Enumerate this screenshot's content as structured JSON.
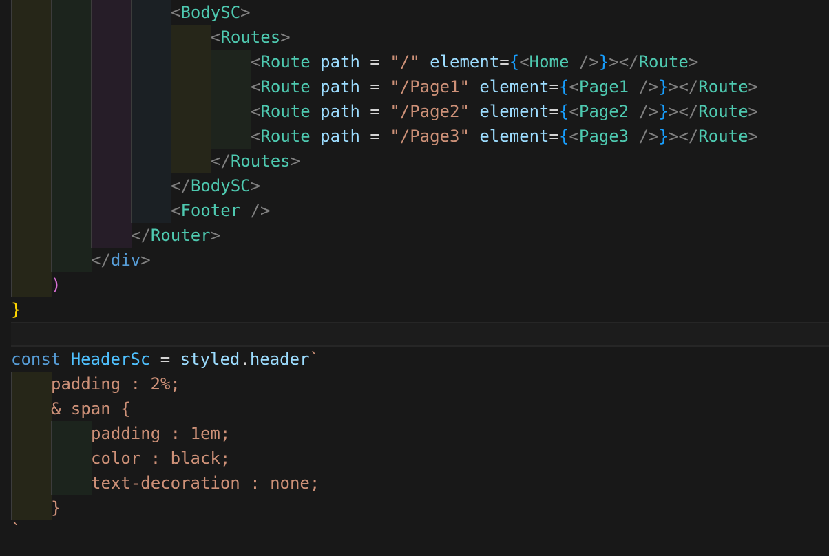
{
  "editor": {
    "lines": [
      [
        {
          "t": "<",
          "c": "punc"
        },
        {
          "t": "BodySC",
          "c": "tag"
        },
        {
          "t": ">",
          "c": "punc"
        }
      ],
      [
        {
          "t": "<",
          "c": "punc"
        },
        {
          "t": "Routes",
          "c": "tag"
        },
        {
          "t": ">",
          "c": "punc"
        }
      ],
      [
        {
          "t": "<",
          "c": "punc"
        },
        {
          "t": "Route",
          "c": "tag"
        },
        {
          "t": " ",
          "c": "op"
        },
        {
          "t": "path",
          "c": "attr"
        },
        {
          "t": " = ",
          "c": "op"
        },
        {
          "t": "\"/\"",
          "c": "str"
        },
        {
          "t": " ",
          "c": "op"
        },
        {
          "t": "element",
          "c": "attr"
        },
        {
          "t": "=",
          "c": "op"
        },
        {
          "t": "{",
          "c": "brace"
        },
        {
          "t": "<",
          "c": "punc"
        },
        {
          "t": "Home",
          "c": "tag"
        },
        {
          "t": " />",
          "c": "punc"
        },
        {
          "t": "}",
          "c": "brace"
        },
        {
          "t": "></",
          "c": "punc"
        },
        {
          "t": "Route",
          "c": "tag"
        },
        {
          "t": ">",
          "c": "punc"
        }
      ],
      [
        {
          "t": "<",
          "c": "punc"
        },
        {
          "t": "Route",
          "c": "tag"
        },
        {
          "t": " ",
          "c": "op"
        },
        {
          "t": "path",
          "c": "attr"
        },
        {
          "t": " = ",
          "c": "op"
        },
        {
          "t": "\"/Page1\"",
          "c": "str"
        },
        {
          "t": " ",
          "c": "op"
        },
        {
          "t": "element",
          "c": "attr"
        },
        {
          "t": "=",
          "c": "op"
        },
        {
          "t": "{",
          "c": "brace"
        },
        {
          "t": "<",
          "c": "punc"
        },
        {
          "t": "Page1",
          "c": "tag"
        },
        {
          "t": " />",
          "c": "punc"
        },
        {
          "t": "}",
          "c": "brace"
        },
        {
          "t": "></",
          "c": "punc"
        },
        {
          "t": "Route",
          "c": "tag"
        },
        {
          "t": ">",
          "c": "punc"
        }
      ],
      [
        {
          "t": "<",
          "c": "punc"
        },
        {
          "t": "Route",
          "c": "tag"
        },
        {
          "t": " ",
          "c": "op"
        },
        {
          "t": "path",
          "c": "attr"
        },
        {
          "t": " = ",
          "c": "op"
        },
        {
          "t": "\"/Page2\"",
          "c": "str"
        },
        {
          "t": " ",
          "c": "op"
        },
        {
          "t": "element",
          "c": "attr"
        },
        {
          "t": "=",
          "c": "op"
        },
        {
          "t": "{",
          "c": "brace"
        },
        {
          "t": "<",
          "c": "punc"
        },
        {
          "t": "Page2",
          "c": "tag"
        },
        {
          "t": " />",
          "c": "punc"
        },
        {
          "t": "}",
          "c": "brace"
        },
        {
          "t": "></",
          "c": "punc"
        },
        {
          "t": "Route",
          "c": "tag"
        },
        {
          "t": ">",
          "c": "punc"
        }
      ],
      [
        {
          "t": "<",
          "c": "punc"
        },
        {
          "t": "Route",
          "c": "tag"
        },
        {
          "t": " ",
          "c": "op"
        },
        {
          "t": "path",
          "c": "attr"
        },
        {
          "t": " = ",
          "c": "op"
        },
        {
          "t": "\"/Page3\"",
          "c": "str"
        },
        {
          "t": " ",
          "c": "op"
        },
        {
          "t": "element",
          "c": "attr"
        },
        {
          "t": "=",
          "c": "op"
        },
        {
          "t": "{",
          "c": "brace"
        },
        {
          "t": "<",
          "c": "punc"
        },
        {
          "t": "Page3",
          "c": "tag"
        },
        {
          "t": " />",
          "c": "punc"
        },
        {
          "t": "}",
          "c": "brace"
        },
        {
          "t": "></",
          "c": "punc"
        },
        {
          "t": "Route",
          "c": "tag"
        },
        {
          "t": ">",
          "c": "punc"
        }
      ],
      [
        {
          "t": "</",
          "c": "punc"
        },
        {
          "t": "Routes",
          "c": "tag"
        },
        {
          "t": ">",
          "c": "punc"
        }
      ],
      [
        {
          "t": "</",
          "c": "punc"
        },
        {
          "t": "BodySC",
          "c": "tag"
        },
        {
          "t": ">",
          "c": "punc"
        }
      ],
      [
        {
          "t": "<",
          "c": "punc"
        },
        {
          "t": "Footer",
          "c": "tag"
        },
        {
          "t": " />",
          "c": "punc"
        }
      ],
      [
        {
          "t": "</",
          "c": "punc"
        },
        {
          "t": "Router",
          "c": "tag"
        },
        {
          "t": ">",
          "c": "punc"
        }
      ],
      [
        {
          "t": "</",
          "c": "punc"
        },
        {
          "t": "div",
          "c": "html"
        },
        {
          "t": ">",
          "c": "punc"
        }
      ],
      [
        {
          "t": ")",
          "c": "paren"
        }
      ],
      [
        {
          "t": "}",
          "c": "gold"
        }
      ],
      [],
      [
        {
          "t": "const",
          "c": "kw"
        },
        {
          "t": " ",
          "c": "op"
        },
        {
          "t": "HeaderSc",
          "c": "var"
        },
        {
          "t": " = ",
          "c": "op"
        },
        {
          "t": "styled",
          "c": "attr"
        },
        {
          "t": ".",
          "c": "op"
        },
        {
          "t": "header",
          "c": "attr"
        },
        {
          "t": "`",
          "c": "css"
        }
      ],
      [
        {
          "t": "padding : 2%;",
          "c": "css"
        }
      ],
      [
        {
          "t": "& span {",
          "c": "css"
        }
      ],
      [
        {
          "t": "padding : 1em;",
          "c": "css"
        }
      ],
      [
        {
          "t": "color : black;",
          "c": "css"
        }
      ],
      [
        {
          "t": "text-decoration : none;",
          "c": "css"
        }
      ],
      [
        {
          "t": "}",
          "c": "css"
        }
      ],
      [
        {
          "t": "`",
          "c": "css"
        }
      ]
    ]
  }
}
